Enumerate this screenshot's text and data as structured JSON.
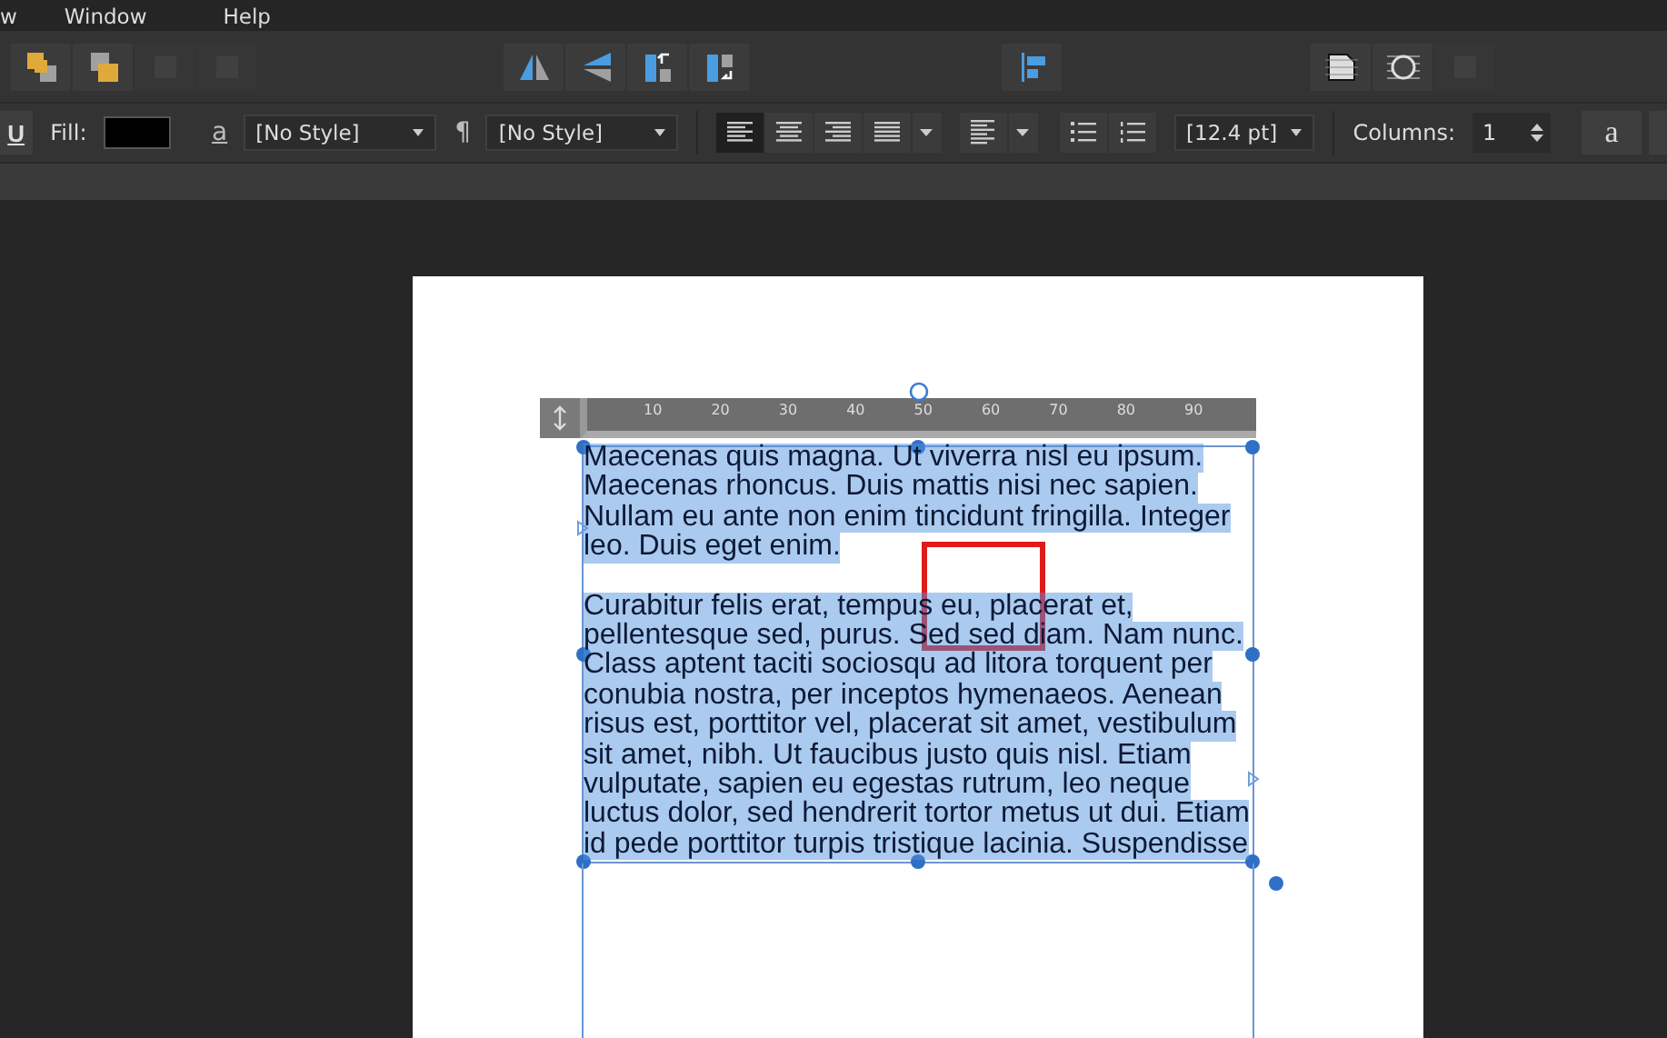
{
  "menu": [
    "w",
    "Window",
    "Help"
  ],
  "toolbar": {
    "groups": [
      {
        "kind": "arrange",
        "buttons": [
          {
            "kind": "bring",
            "disabled": false
          },
          {
            "kind": "send",
            "disabled": false
          },
          {
            "kind": "square",
            "disabled": true
          },
          {
            "kind": "square",
            "disabled": true
          }
        ]
      },
      {
        "kind": "flip",
        "buttons": [
          {
            "kind": "fliph",
            "disabled": false
          },
          {
            "kind": "flipv",
            "disabled": false
          },
          {
            "kind": "rotl",
            "disabled": false
          },
          {
            "kind": "rotr",
            "disabled": false
          }
        ]
      },
      {
        "kind": "align",
        "buttons": [
          {
            "kind": "alignleft",
            "disabled": false
          }
        ]
      },
      {
        "kind": "wrap",
        "buttons": [
          {
            "kind": "page",
            "disabled": false
          },
          {
            "kind": "circle",
            "disabled": false
          },
          {
            "kind": "square",
            "disabled": true
          }
        ]
      }
    ]
  },
  "format_bar": {
    "underline": "U",
    "fill_label": "Fill:",
    "char_style_icon": "a",
    "char_style": "[No Style]",
    "para_style_icon": "¶",
    "para_style": "[No Style]",
    "alignment": [
      {
        "kind": "left",
        "selected": true
      },
      {
        "kind": "center",
        "selected": false
      },
      {
        "kind": "right",
        "selected": false
      },
      {
        "kind": "justify",
        "selected": false
      }
    ],
    "leading": "[12.4 pt]",
    "columns_label": "Columns:",
    "columns": "1",
    "typo_button": "a"
  },
  "ruler": [
    "10",
    "20",
    "30",
    "40",
    "50",
    "60",
    "70",
    "80",
    "90"
  ],
  "text_frame": {
    "text_selected": true,
    "paragraphs": [
      [
        "Maecenas quis magna. Ut viverra nisl eu ipsum.",
        "Maecenas rhoncus. Duis mattis nisi nec sapien.",
        "Nullam eu ante non enim tincidunt fringilla. Integer",
        "leo. Duis eget enim."
      ],
      [
        "Curabitur felis erat, tempus eu, placerat et,",
        "pellentesque sed, purus. Sed sed diam. Nam nunc.",
        "Class aptent taciti sociosqu ad litora torquent per",
        "conubia nostra, per inceptos hymenaeos. Aenean",
        "risus est, porttitor vel, placerat sit amet, vestibulum",
        "sit amet, nibh. Ut faucibus justo quis nisl. Etiam",
        "vulputate, sapien eu egestas rutrum, leo neque",
        "luctus dolor, sed hendrerit tortor metus ut dui. Etiam",
        "id pede porttitor turpis tristique lacinia. Suspendisse"
      ]
    ]
  }
}
